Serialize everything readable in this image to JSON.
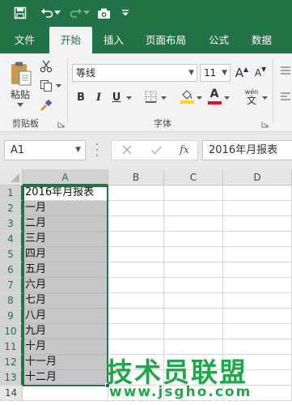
{
  "quick_access": {
    "icons": [
      "save-icon",
      "undo-icon",
      "redo-icon",
      "camera-icon",
      "customize-icon"
    ]
  },
  "ribbon_tabs": [
    {
      "label": "文件",
      "active": false
    },
    {
      "label": "开始",
      "active": true
    },
    {
      "label": "插入",
      "active": false
    },
    {
      "label": "页面布局",
      "active": false
    },
    {
      "label": "公式",
      "active": false
    },
    {
      "label": "数据",
      "active": false
    }
  ],
  "clipboard": {
    "paste_label": "粘贴",
    "group_label": "剪贴板"
  },
  "font_group": {
    "font_name": "等线",
    "font_size": "11",
    "grow_label": "A",
    "shrink_label": "A",
    "bold_label": "B",
    "italic_label": "I",
    "underline_label": "U",
    "font_color_label": "A",
    "phonetic_label": "wén",
    "phonetic_char": "文",
    "group_label": "字体",
    "fill_color": "#ffd700",
    "font_color": "#e81123"
  },
  "formula_bar": {
    "name_box": "A1",
    "fx_label": "fx",
    "content": "2016年月报表"
  },
  "grid": {
    "columns": [
      "A",
      "B",
      "C",
      "D"
    ],
    "rows": [
      "1",
      "2",
      "3",
      "4",
      "5",
      "6",
      "7",
      "8",
      "9",
      "10",
      "11",
      "12",
      "13",
      "14"
    ],
    "cells_a": [
      "2016年月报表",
      "一月",
      "二月",
      "三月",
      "四月",
      "五月",
      "六月",
      "七月",
      "八月",
      "九月",
      "十月",
      "十一月",
      "十二月",
      ""
    ]
  },
  "watermark": {
    "title": "技术员联盟",
    "url": "www.jsgho.com"
  },
  "colors": {
    "brand": "#217346",
    "selection_fill": "#c6c6c6"
  }
}
